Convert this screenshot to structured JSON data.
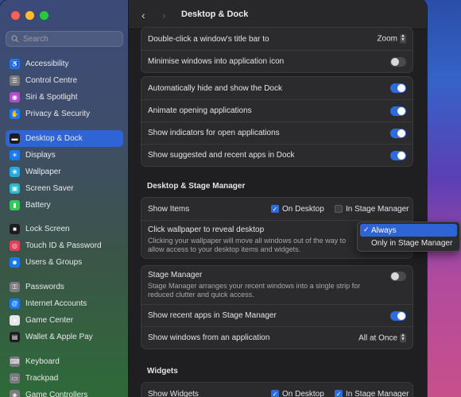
{
  "window": {
    "title": "Desktop & Dock"
  },
  "colors": {
    "accent": "#2f64d6",
    "toggle_on": "#2f6be0",
    "window_bg": "#1f1f21"
  },
  "search": {
    "placeholder": "Search"
  },
  "sidebar": {
    "groups": [
      [
        {
          "label": "Accessibility",
          "icon": "accessibility-icon",
          "color": "#1a78f0"
        },
        {
          "label": "Control Centre",
          "icon": "control-centre-icon",
          "color": "#7b7b80"
        },
        {
          "label": "Siri & Spotlight",
          "icon": "siri-icon",
          "color": "#b04fc8"
        },
        {
          "label": "Privacy & Security",
          "icon": "hand-icon",
          "color": "#1a78f0"
        }
      ],
      [
        {
          "label": "Desktop & Dock",
          "icon": "dock-icon",
          "color": "#1c1c1e",
          "active": true
        },
        {
          "label": "Displays",
          "icon": "displays-icon",
          "color": "#1a78f0"
        },
        {
          "label": "Wallpaper",
          "icon": "wallpaper-icon",
          "color": "#27a9e0"
        },
        {
          "label": "Screen Saver",
          "icon": "screen-saver-icon",
          "color": "#2fb8c8"
        },
        {
          "label": "Battery",
          "icon": "battery-icon",
          "color": "#34c759"
        }
      ],
      [
        {
          "label": "Lock Screen",
          "icon": "lock-icon",
          "color": "#1c1c1e"
        },
        {
          "label": "Touch ID & Password",
          "icon": "fingerprint-icon",
          "color": "#e0405a"
        },
        {
          "label": "Users & Groups",
          "icon": "users-icon",
          "color": "#1a78f0"
        }
      ],
      [
        {
          "label": "Passwords",
          "icon": "key-icon",
          "color": "#7b7b80"
        },
        {
          "label": "Internet Accounts",
          "icon": "at-icon",
          "color": "#1a78f0"
        },
        {
          "label": "Game Center",
          "icon": "game-center-icon",
          "color": "#e8e8ea"
        },
        {
          "label": "Wallet & Apple Pay",
          "icon": "wallet-icon",
          "color": "#1c1c1e"
        }
      ],
      [
        {
          "label": "Keyboard",
          "icon": "keyboard-icon",
          "color": "#7b7b80"
        },
        {
          "label": "Trackpad",
          "icon": "trackpad-icon",
          "color": "#7b7b80"
        },
        {
          "label": "Game Controllers",
          "icon": "controller-icon",
          "color": "#7b7b80"
        }
      ]
    ]
  },
  "main": {
    "titlebar_group": {
      "double_click": {
        "label": "Double-click a window's title bar to",
        "value": "Zoom"
      },
      "minimise": {
        "label": "Minimise windows into application icon",
        "on": false
      }
    },
    "dock_group": [
      {
        "label": "Automatically hide and show the Dock",
        "on": true
      },
      {
        "label": "Animate opening applications",
        "on": true
      },
      {
        "label": "Show indicators for open applications",
        "on": true
      },
      {
        "label": "Show suggested and recent apps in Dock",
        "on": true
      }
    ],
    "desktop_section": {
      "title": "Desktop & Stage Manager",
      "show_items": {
        "label": "Show Items",
        "on_desktop": "On Desktop",
        "in_stage_manager": "In Stage Manager"
      },
      "click_wallpaper": {
        "label": "Click wallpaper to reveal desktop",
        "description": "Clicking your wallpaper will move all windows out of the way to allow access to your desktop items and widgets."
      },
      "stage_manager": {
        "label": "Stage Manager",
        "description": "Stage Manager arranges your recent windows into a single strip for reduced clutter and quick access.",
        "on": false
      },
      "recent_apps": {
        "label": "Show recent apps in Stage Manager",
        "on": true
      },
      "show_windows": {
        "label": "Show windows from an application",
        "value": "All at Once"
      }
    },
    "widgets_section": {
      "title": "Widgets",
      "show_widgets": {
        "label": "Show Widgets",
        "on_desktop": "On Desktop",
        "in_stage_manager": "In Stage Manager"
      }
    }
  },
  "dropdown": {
    "options": [
      "Always",
      "Only in Stage Manager"
    ],
    "selected": "Always"
  }
}
